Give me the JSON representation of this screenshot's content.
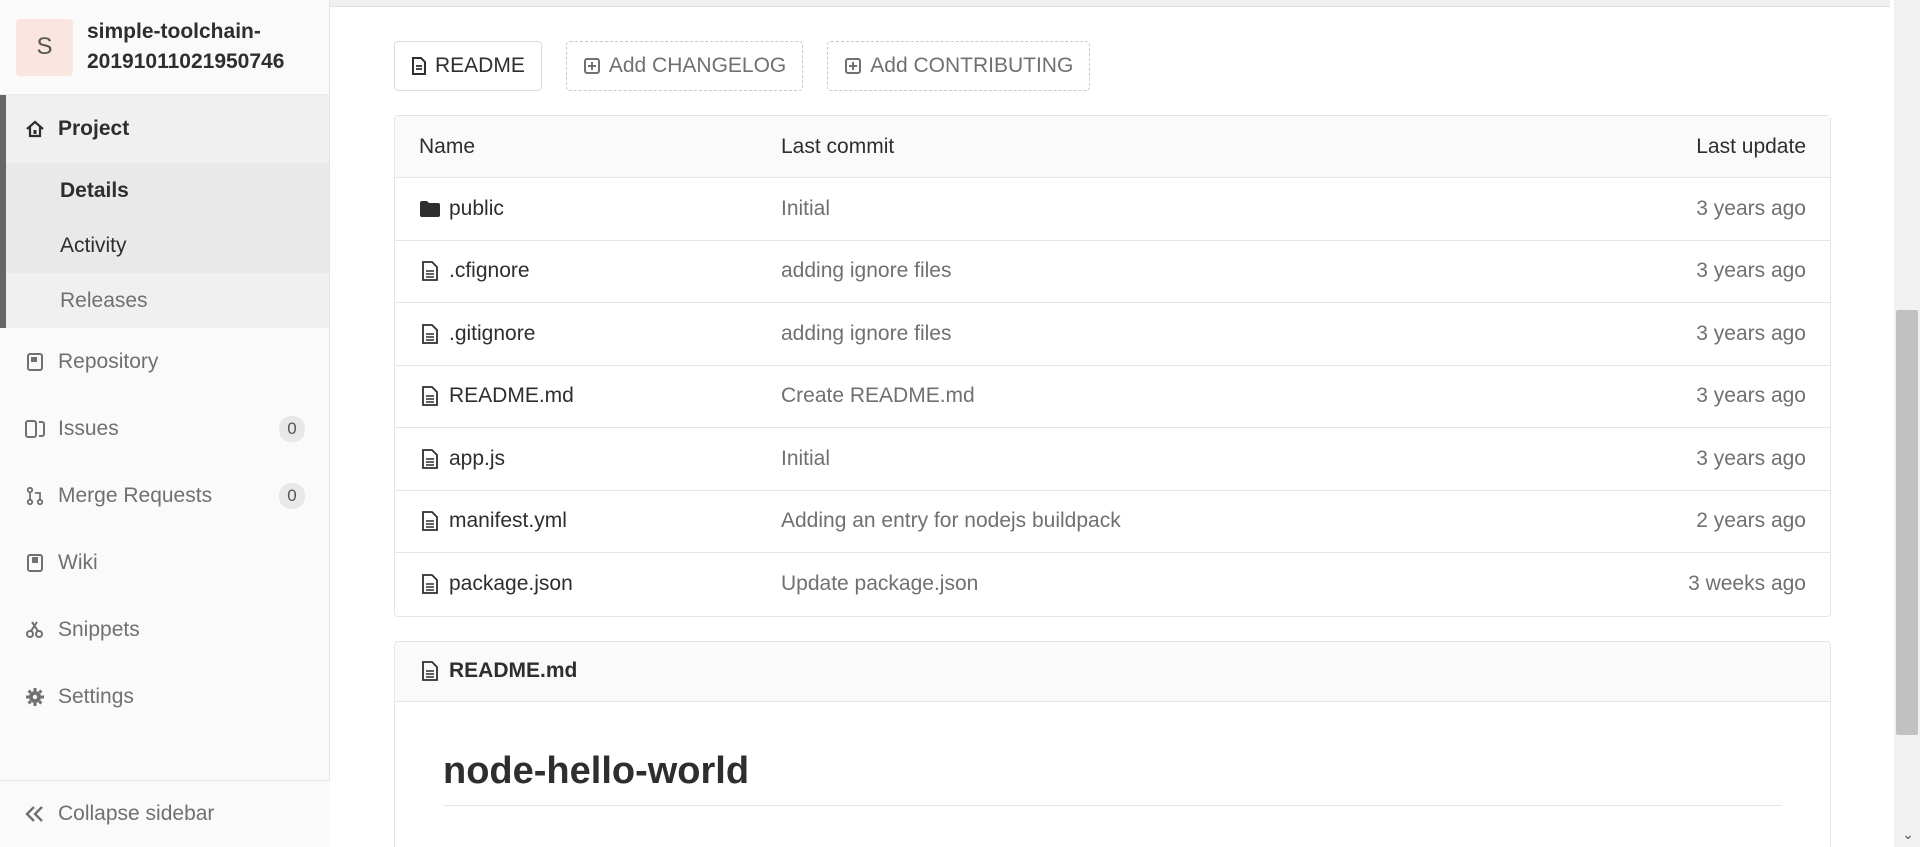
{
  "project": {
    "avatar_letter": "S",
    "name": "simple-toolchain-20191011021950746"
  },
  "sidebar": {
    "project_label": "Project",
    "sub_items": [
      "Details",
      "Activity",
      "Releases"
    ],
    "items": [
      {
        "label": "Repository",
        "icon": "book-icon"
      },
      {
        "label": "Issues",
        "icon": "issues-icon",
        "count": "0"
      },
      {
        "label": "Merge Requests",
        "icon": "merge-request-icon",
        "count": "0"
      },
      {
        "label": "Wiki",
        "icon": "wiki-icon"
      },
      {
        "label": "Snippets",
        "icon": "scissors-icon"
      },
      {
        "label": "Settings",
        "icon": "gear-icon"
      }
    ],
    "collapse_label": "Collapse sidebar"
  },
  "buttons": {
    "readme": "README",
    "add_changelog": "Add CHANGELOG",
    "add_contributing": "Add CONTRIBUTING"
  },
  "tree": {
    "headers": {
      "name": "Name",
      "commit": "Last commit",
      "update": "Last update"
    },
    "rows": [
      {
        "name": "public",
        "type": "folder",
        "commit": "Initial",
        "update": "3 years ago"
      },
      {
        "name": ".cfignore",
        "type": "file",
        "commit": "adding ignore files",
        "update": "3 years ago"
      },
      {
        "name": ".gitignore",
        "type": "file",
        "commit": "adding ignore files",
        "update": "3 years ago"
      },
      {
        "name": "README.md",
        "type": "file",
        "commit": "Create README.md",
        "update": "3 years ago"
      },
      {
        "name": "app.js",
        "type": "file",
        "commit": "Initial",
        "update": "3 years ago"
      },
      {
        "name": "manifest.yml",
        "type": "file",
        "commit": "Adding an entry for nodejs buildpack",
        "update": "2 years ago"
      },
      {
        "name": "package.json",
        "type": "file",
        "commit": "Update package.json",
        "update": "3 weeks ago"
      }
    ]
  },
  "readme": {
    "filename": "README.md",
    "title": "node-hello-world"
  }
}
